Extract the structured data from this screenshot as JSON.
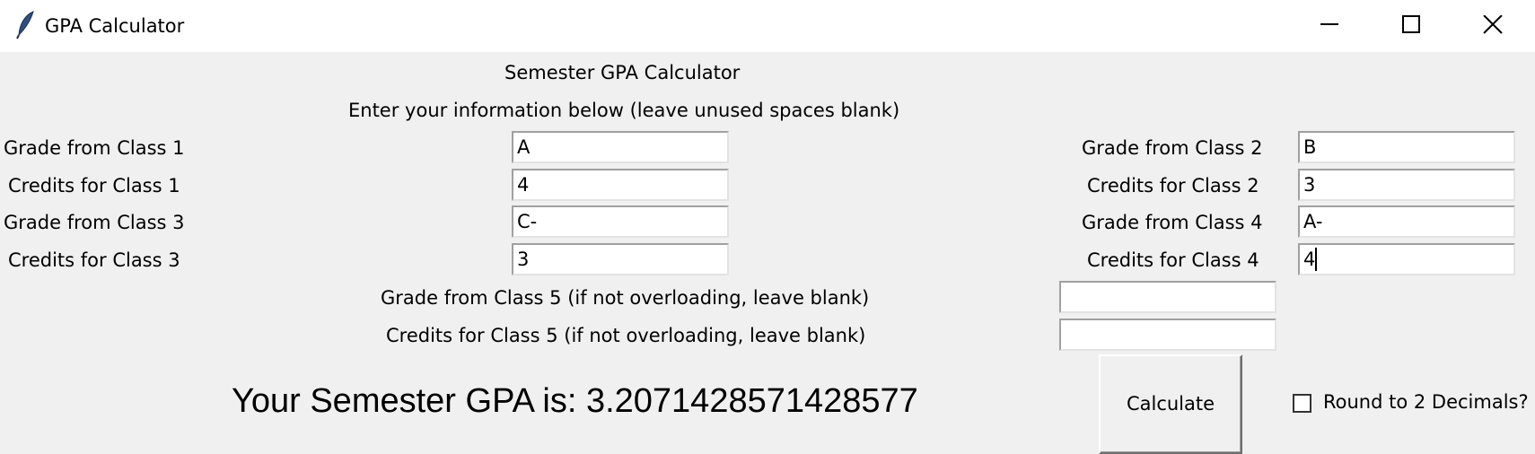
{
  "window": {
    "title": "GPA Calculator",
    "icon": "feather-icon"
  },
  "header": {
    "title": "Semester GPA Calculator",
    "instructions": "Enter your information below (leave unused spaces blank)"
  },
  "form": {
    "class1": {
      "grade_label": "Grade from Class 1",
      "grade_value": "A",
      "credits_label": "Credits for Class 1",
      "credits_value": "4"
    },
    "class2": {
      "grade_label": "Grade from Class 2",
      "grade_value": "B",
      "credits_label": "Credits for Class 2",
      "credits_value": "3"
    },
    "class3": {
      "grade_label": "Grade from Class 3",
      "grade_value": "C-",
      "credits_label": "Credits for Class 3",
      "credits_value": "3"
    },
    "class4": {
      "grade_label": "Grade from Class 4",
      "grade_value": "A-",
      "credits_label": "Credits for Class 4",
      "credits_value": "4"
    },
    "class5": {
      "grade_label": "Grade from Class 5 (if not overloading, leave blank)",
      "grade_value": "",
      "credits_label": "Credits for Class 5 (if not overloading, leave blank)",
      "credits_value": ""
    }
  },
  "result": {
    "text": "Your Semester GPA is: 3.2071428571428577"
  },
  "actions": {
    "calculate_label": "Calculate",
    "round_label": "Round to 2 Decimals?",
    "round_checked": false
  }
}
